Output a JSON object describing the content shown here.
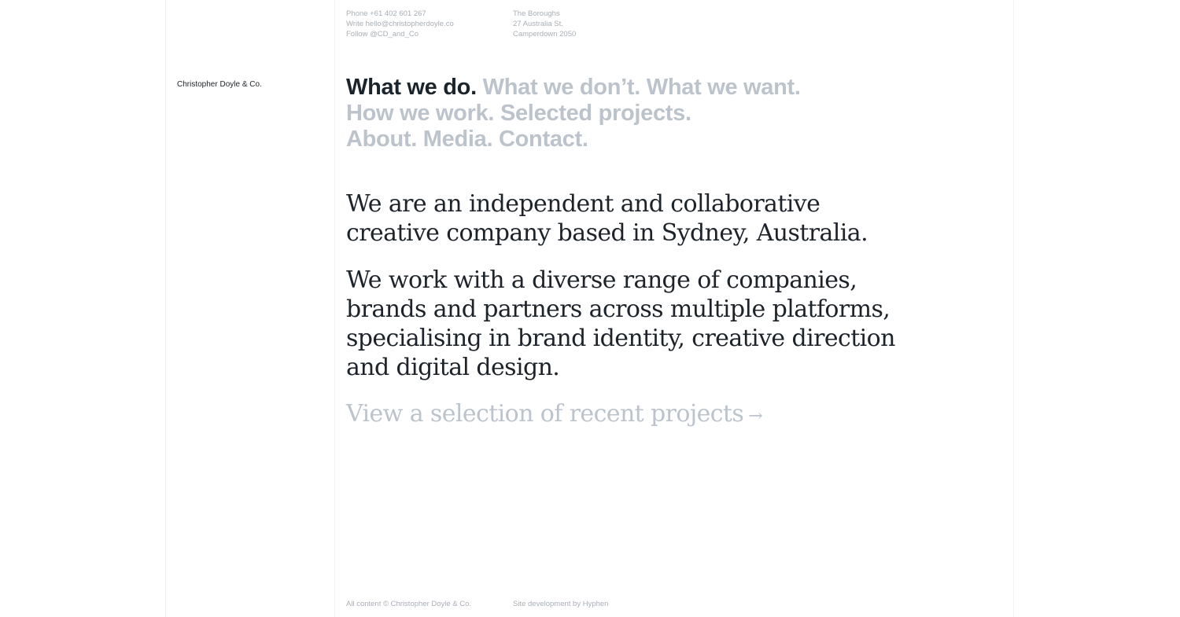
{
  "contact": {
    "phone": "Phone +61 402 601 267",
    "email": "Write hello@christopherdoyle.co",
    "social": "Follow @CD_and_Co"
  },
  "address": {
    "line1": "The Boroughs",
    "line2": "27 Australia St.",
    "line3": "Camperdown 2050"
  },
  "brand": "Christopher Doyle & Co.",
  "nav": {
    "what_we_do": "What we do.",
    "what_we_dont": "What we don’t.",
    "what_we_want": "What we want.",
    "how_we_work": "How we work.",
    "selected_projects": "Selected projects.",
    "about": "About.",
    "media": "Media.",
    "contact": "Contact."
  },
  "intro": {
    "p1_lines": [
      "We are an independent and collaborative",
      "creative company based in Sydney, Australia."
    ],
    "p2_lines": [
      "We work with a diverse range of companies,",
      "brands and partners across multiple platforms,",
      "specialising in brand identity, creative direction",
      "and digital design."
    ]
  },
  "cta": {
    "label": "View a selection of recent projects",
    "arrow": "→"
  },
  "footer": {
    "copyright": "All content © Christopher Doyle & Co.",
    "credit": "Site development by Hyphen"
  },
  "colors": {
    "text_dark": "#1d2329",
    "text_muted": "#bcc3cb",
    "text_small": "#a9afb6",
    "rule": "#f1f2f4"
  }
}
